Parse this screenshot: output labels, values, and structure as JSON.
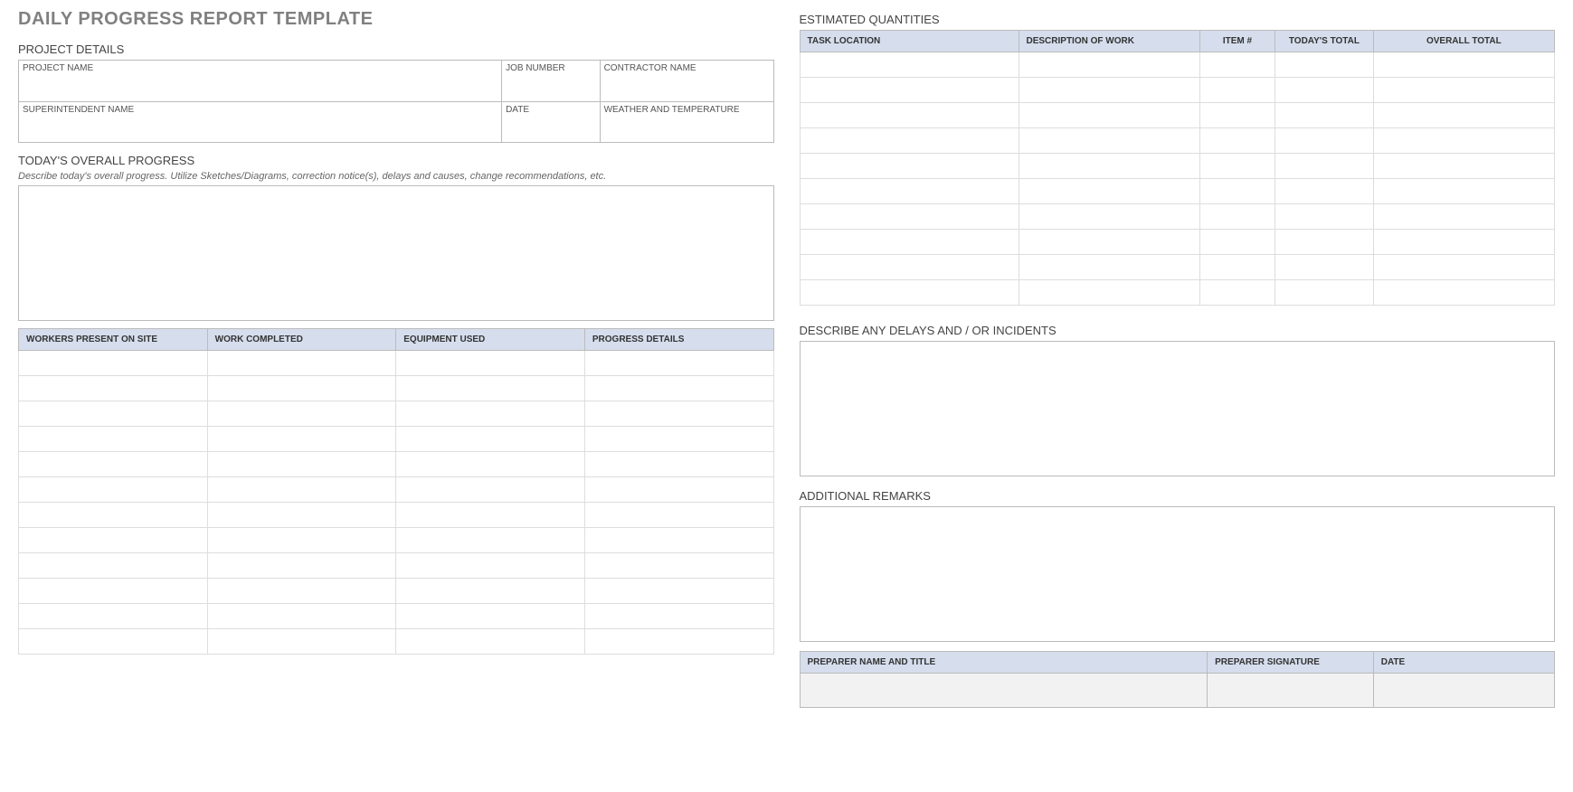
{
  "title": "DAILY PROGRESS REPORT TEMPLATE",
  "sections": {
    "project_details": "PROJECT DETAILS",
    "overall_progress": "TODAY'S OVERALL PROGRESS",
    "progress_hint": "Describe today's overall progress.  Utilize Sketches/Diagrams, correction notice(s), delays and causes, change recommendations, etc.",
    "estimated_quantities": "ESTIMATED QUANTITIES",
    "delays": "DESCRIBE ANY DELAYS AND / OR INCIDENTS",
    "remarks": "ADDITIONAL REMARKS"
  },
  "details": {
    "row1": {
      "c1": "PROJECT NAME",
      "c2": "JOB NUMBER",
      "c3": "CONTRACTOR NAME"
    },
    "row2": {
      "c1": "SUPERINTENDENT NAME",
      "c2": "DATE",
      "c3": "WEATHER AND TEMPERATURE"
    }
  },
  "progress_table": {
    "headers": [
      "WORKERS PRESENT ON SITE",
      "WORK COMPLETED",
      "EQUIPMENT USED",
      "PROGRESS DETAILS"
    ],
    "rows": 12
  },
  "quantities_table": {
    "headers": [
      "TASK LOCATION",
      "DESCRIPTION OF WORK",
      "ITEM #",
      "TODAY'S TOTAL",
      "OVERALL TOTAL"
    ],
    "widths": [
      "29%",
      "24%",
      "10%",
      "13%",
      "24%"
    ],
    "rows": 10
  },
  "signature": {
    "headers": [
      "PREPARER NAME AND TITLE",
      "PREPARER SIGNATURE",
      "DATE"
    ],
    "widths": [
      "54%",
      "22%",
      "24%"
    ]
  }
}
